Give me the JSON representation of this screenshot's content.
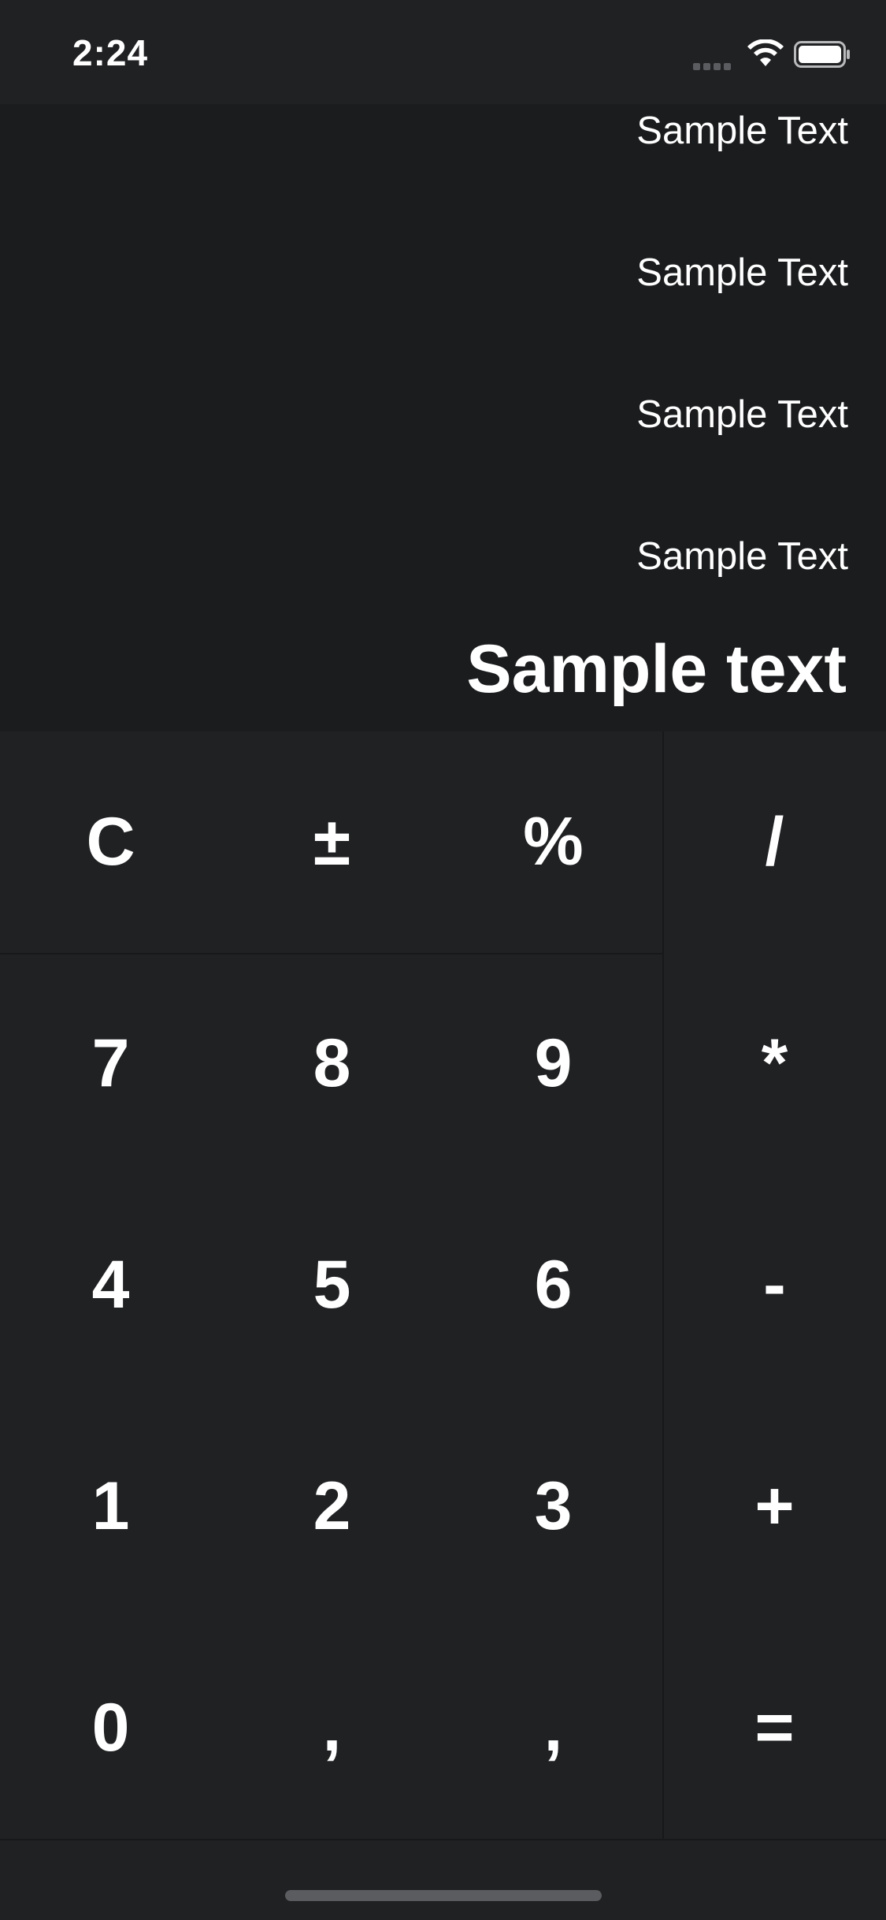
{
  "status_bar": {
    "time": "2:24"
  },
  "display": {
    "history": [
      "Sample Text",
      "Sample Text",
      "Sample Text",
      "Sample Text"
    ],
    "result": "Sample text"
  },
  "keypad": {
    "row1": [
      "C",
      "±",
      "%",
      "/"
    ],
    "row2": [
      "7",
      "8",
      "9",
      "*"
    ],
    "row3": [
      "4",
      "5",
      "6",
      "-"
    ],
    "row4": [
      "1",
      "2",
      "3",
      "+"
    ],
    "row5": [
      "0",
      ",",
      ",",
      "="
    ]
  },
  "colors": {
    "background": "#202123",
    "display_background": "#1b1c1e",
    "text": "#ffffff",
    "divider": "#17181a",
    "indicator": "#5b5c5f"
  },
  "icons": {
    "signal": "signal-dots-icon",
    "wifi": "wifi-icon",
    "battery": "battery-icon"
  }
}
